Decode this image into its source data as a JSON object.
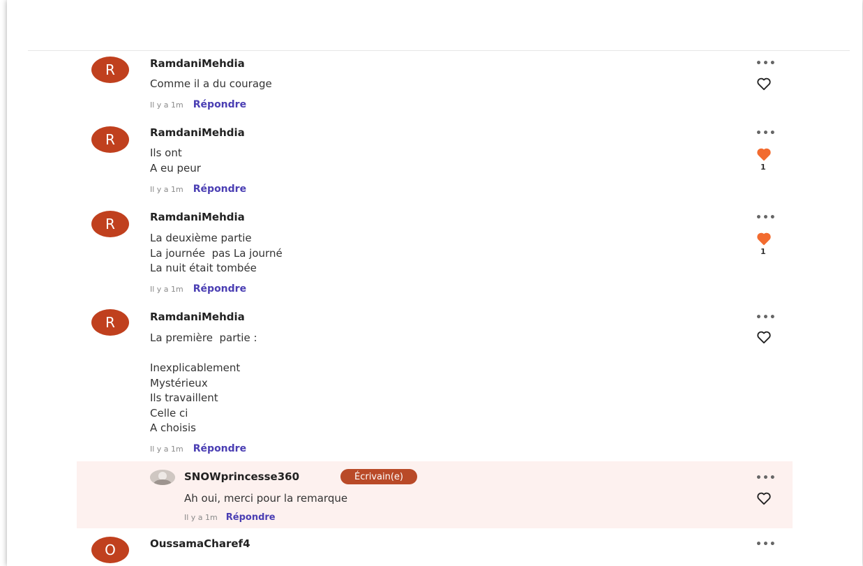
{
  "comments": [
    {
      "username": "RamdaniMehdia",
      "avatar_letter": "R",
      "lines": [
        "Comme il a du courage"
      ],
      "time": "Il y a 1m",
      "reply_label": "Répondre",
      "liked": false,
      "likes": ""
    },
    {
      "username": "RamdaniMehdia",
      "avatar_letter": "R",
      "lines": [
        "Ils ont",
        "A eu peur"
      ],
      "time": "Il y a 1m",
      "reply_label": "Répondre",
      "liked": true,
      "likes": "1"
    },
    {
      "username": "RamdaniMehdia",
      "avatar_letter": "R",
      "lines": [
        "La deuxième partie",
        "La journée  pas La journé",
        "La nuit était tombée"
      ],
      "time": "Il y a 1m",
      "reply_label": "Répondre",
      "liked": true,
      "likes": "1"
    },
    {
      "username": "RamdaniMehdia",
      "avatar_letter": "R",
      "lines": [
        "La première  partie :",
        "",
        "Inexplicablement",
        "Mystérieux",
        "Ils travaillent",
        "Celle ci",
        "A choisis"
      ],
      "time": "Il y a 1m",
      "reply_label": "Répondre",
      "liked": false,
      "likes": ""
    }
  ],
  "reply": {
    "username": "SNOWprincesse360",
    "badge": "Écrivain(e)",
    "text": "Ah oui, merci pour la remarque",
    "time": "Il y a 1m",
    "reply_label": "Répondre",
    "liked": false
  },
  "last_comment": {
    "username": "OussamaCharef4",
    "avatar_letter": "O"
  },
  "more_label": "•••",
  "colors": {
    "avatar": "#c0401e",
    "reply_link": "#4a3eb3",
    "heart_filled": "#f26b2f",
    "badge": "#b94a28",
    "reply_bg": "#fdf1ef"
  }
}
